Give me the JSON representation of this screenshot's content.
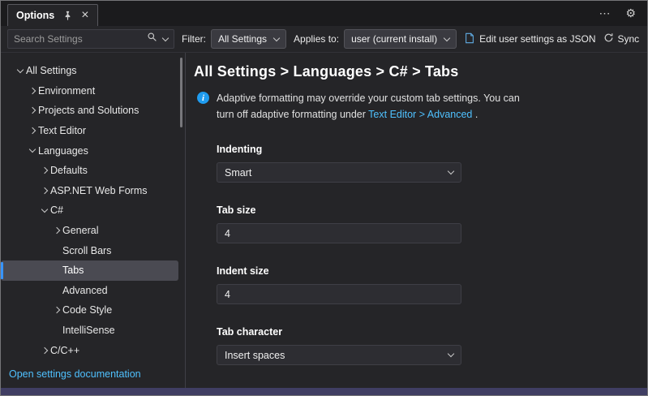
{
  "titlebar": {
    "tab_label": "Options"
  },
  "toolbar": {
    "search_placeholder": "Search Settings",
    "filter_label": "Filter:",
    "filter_value": "All Settings",
    "applies_to_label": "Applies to:",
    "applies_to_value": "user (current install)",
    "edit_json_label": "Edit user settings as JSON",
    "sync_label": "Sync"
  },
  "sidebar": {
    "items": [
      {
        "label": "All Settings",
        "level": 0,
        "state": "expanded"
      },
      {
        "label": "Environment",
        "level": 1,
        "state": "collapsed"
      },
      {
        "label": "Projects and Solutions",
        "level": 1,
        "state": "collapsed"
      },
      {
        "label": "Text Editor",
        "level": 1,
        "state": "collapsed"
      },
      {
        "label": "Languages",
        "level": 1,
        "state": "expanded"
      },
      {
        "label": "Defaults",
        "level": 2,
        "state": "collapsed"
      },
      {
        "label": "ASP.NET Web Forms",
        "level": 2,
        "state": "collapsed"
      },
      {
        "label": "C#",
        "level": 2,
        "state": "expanded"
      },
      {
        "label": "General",
        "level": 3,
        "state": "collapsed"
      },
      {
        "label": "Scroll Bars",
        "level": 3,
        "state": "leaf"
      },
      {
        "label": "Tabs",
        "level": 3,
        "state": "leaf",
        "selected": true
      },
      {
        "label": "Advanced",
        "level": 3,
        "state": "leaf"
      },
      {
        "label": "Code Style",
        "level": 3,
        "state": "collapsed"
      },
      {
        "label": "IntelliSense",
        "level": 3,
        "state": "leaf"
      },
      {
        "label": "C/C++",
        "level": 2,
        "state": "collapsed"
      }
    ],
    "doc_link": "Open settings documentation"
  },
  "content": {
    "breadcrumb": "All Settings > Languages > C# > Tabs",
    "info": {
      "line1": "Adaptive formatting may override your custom tab settings. You can",
      "line2_prefix": "turn off adaptive formatting under",
      "link": "Text Editor > Advanced",
      "suffix": " ."
    },
    "fields": {
      "indenting": {
        "label": "Indenting",
        "value": "Smart"
      },
      "tab_size": {
        "label": "Tab size",
        "value": "4"
      },
      "indent_size": {
        "label": "Indent size",
        "value": "4"
      },
      "tab_character": {
        "label": "Tab character",
        "value": "Insert spaces"
      }
    }
  },
  "colors": {
    "accent": "#3794ff",
    "link": "#4fc1ff",
    "info_icon": "#1f9cf0",
    "status_strip": "#403e63"
  }
}
